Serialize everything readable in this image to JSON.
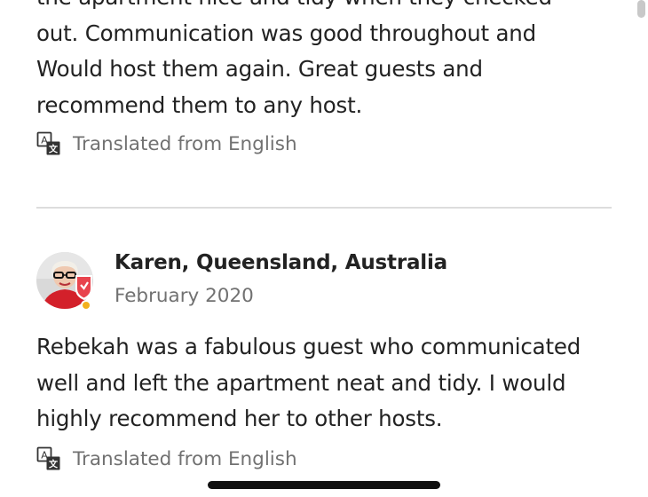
{
  "review_1": {
    "lines": [
      "the apartment nice and tidy when they checked",
      "out. Communication was good throughout and",
      "Would host them again. Great guests and",
      "recommend them to any host."
    ],
    "translated_label": "Translated from English"
  },
  "review_2": {
    "reviewer_name": "Karen, Queensland, Australia",
    "date": "February 2020",
    "lines": [
      "Rebekah was a fabulous guest who communicated",
      "well and left the apartment neat and tidy. I would",
      "highly recommend her to other hosts."
    ],
    "translated_label": "Translated from English"
  },
  "icons": {
    "translate": "translate-icon",
    "avatar": "avatar",
    "superhost_badge": "superhost-badge-icon"
  },
  "colors": {
    "text_primary": "#222222",
    "text_secondary": "#717171",
    "divider": "#dddddd",
    "badge_red": "#e8434d"
  }
}
